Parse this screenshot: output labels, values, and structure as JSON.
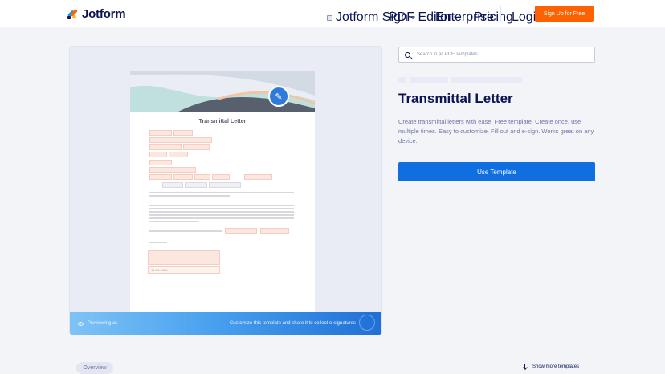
{
  "header": {
    "logo_text": "Jotform",
    "nav": {
      "jotform_sign": "Jotform Sign",
      "pdf_editor": "PDF Editor",
      "enterprise": "Enterprise",
      "pricing": "Pricing",
      "login": "Login",
      "signup": "Sign Up for Free"
    }
  },
  "preview": {
    "document_title": "Transmittal Letter",
    "date_value": "12-14-2023",
    "bar_left": "Previewing as",
    "bar_right": "Customize this template and share it to collect e-signatures"
  },
  "sidebar": {
    "search_placeholder": "Search in all PDF Templates",
    "title": "Transmittal Letter",
    "description": "Create transmittal letters with ease. Free template. Create once, use multiple times. Easy to customize. Fill out and e-sign. Works great on any device.",
    "use_template": "Use Template"
  },
  "footer": {
    "overview": "Overview",
    "show_more": "Show more templates"
  },
  "colors": {
    "brand_orange": "#ff6100",
    "primary_blue": "#0f6fe0",
    "navy": "#0a1551"
  },
  "icons": [
    "jotform-logo-icon",
    "sign-icon",
    "chevron-down-icon",
    "search-icon",
    "pencil-icon",
    "eye-icon",
    "arrow-down-icon"
  ]
}
